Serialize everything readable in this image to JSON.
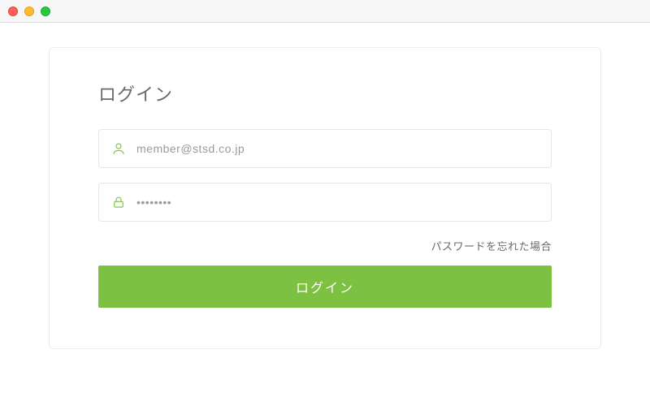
{
  "colors": {
    "accent": "#7cc142",
    "traffic_red": "#ff5f56",
    "traffic_yellow": "#ffbd2e",
    "traffic_green": "#27c93f"
  },
  "login": {
    "title": "ログイン",
    "email_value": "member@stsd.co.jp",
    "email_placeholder": "",
    "password_value": "••••••••",
    "password_placeholder": "",
    "forgot_label": "パスワードを忘れた場合",
    "submit_label": "ログイン"
  }
}
